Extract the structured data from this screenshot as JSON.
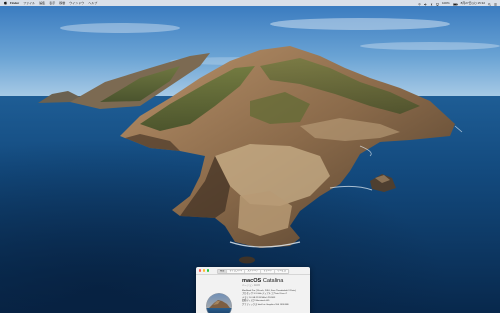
{
  "menubar": {
    "app_name": "Finder",
    "items": [
      "ファイル",
      "編集",
      "表示",
      "移動",
      "ウインドウ",
      "ヘルプ"
    ],
    "status_icons": [
      "wifi-icon",
      "volume-icon",
      "battery-icon",
      "bluetooth-icon",
      "airplay-icon",
      "search-icon",
      "control-center-icon"
    ],
    "battery_text": "100%",
    "datetime": "8月27日(火) 15:32"
  },
  "about_window": {
    "tabs": [
      "概要",
      "ディスプレイ",
      "ストレージ",
      "サポート",
      "サービス"
    ],
    "active_tab": 0,
    "os_name_bold": "macOS",
    "os_name_light": " Catalina",
    "os_version": "バージョン 10.15",
    "specs": [
      "MacBook Pro (13-inch, 2016, Four Thunderbolt 3 Ports)",
      "プロセッサ  3.3 GHz デュアルコアIntel Core i7",
      "メモリ  16 GB 2133 MHz LPDDR3",
      "起動ディスク  Macintosh HD",
      "グラフィックス  Intel Iris Graphics 550 1536 MB"
    ]
  },
  "colors": {
    "traffic_close": "#fe5f57",
    "traffic_minimize": "#febc2e",
    "traffic_zoom": "#28c840",
    "sky_top": "#3e7ec2",
    "sea_deep": "#0b3560"
  }
}
